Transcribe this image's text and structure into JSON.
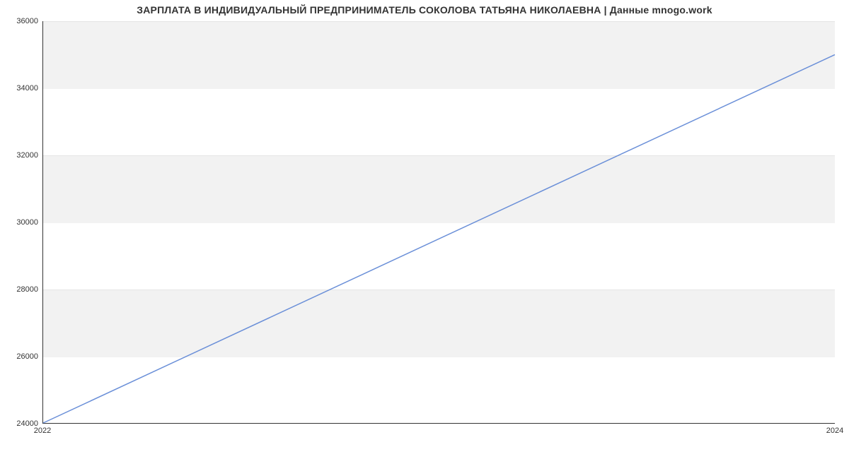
{
  "chart_data": {
    "type": "line",
    "title": "ЗАРПЛАТА В ИНДИВИДУАЛЬНЫЙ ПРЕДПРИНИМАТЕЛЬ СОКОЛОВА ТАТЬЯНА НИКОЛАЕВНА | Данные mnogo.work",
    "x": [
      2022,
      2024
    ],
    "values": [
      24000,
      35000
    ],
    "xlabel": "",
    "ylabel": "",
    "xlim": [
      2022,
      2024
    ],
    "ylim": [
      24000,
      36000
    ],
    "y_ticks": [
      24000,
      26000,
      28000,
      30000,
      32000,
      34000,
      36000
    ],
    "x_ticks": [
      2022,
      2024
    ],
    "line_color": "#6a8fd8",
    "band_color": "#f2f2f2"
  }
}
